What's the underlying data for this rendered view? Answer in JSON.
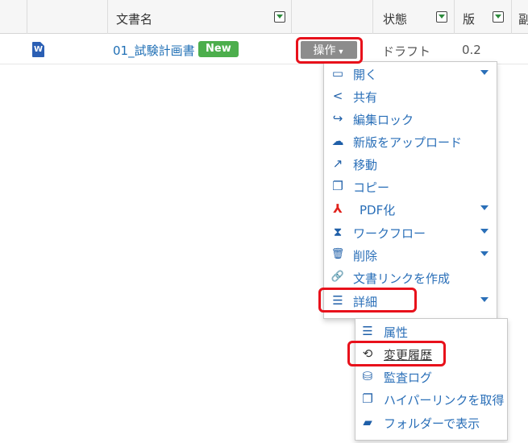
{
  "header": {
    "doc_name_label": "文書名",
    "status_label": "状態",
    "version_label": "版",
    "extra_label": "副"
  },
  "row": {
    "file_type_glyph": "W",
    "doc_name": "01_試験計画書",
    "new_badge": "New",
    "ops_label": "操作",
    "ops_chevron": "▼",
    "status": "ドラフト",
    "version": "0.2"
  },
  "menu": {
    "items": [
      {
        "label": "開く",
        "icon": "monitor-icon",
        "glyph": "▭"
      },
      {
        "label": "共有",
        "icon": "share-icon",
        "glyph": "<"
      },
      {
        "label": "編集ロック",
        "icon": "sign-out-icon",
        "glyph": "↪"
      },
      {
        "label": "新版をアップロード",
        "icon": "cloud-upload-icon",
        "glyph": "☁"
      },
      {
        "label": "移動",
        "icon": "external-link-icon",
        "glyph": "↗"
      },
      {
        "label": "コピー",
        "icon": "copy-icon",
        "glyph": "❐"
      },
      {
        "label": "PDF化",
        "icon": "pdf-icon",
        "glyph": "⅄"
      },
      {
        "label": "ワークフロー",
        "icon": "hourglass-icon",
        "glyph": "⧗"
      },
      {
        "label": "削除",
        "icon": "trash-icon",
        "glyph": "🗑"
      },
      {
        "label": "文書リンクを作成",
        "icon": "link-icon",
        "glyph": "🔗"
      },
      {
        "label": "詳細",
        "icon": "list-icon",
        "glyph": "☰"
      }
    ]
  },
  "submenu": {
    "items": [
      {
        "label": "属性",
        "icon": "list-icon",
        "glyph": "☰"
      },
      {
        "label": "変更履歴",
        "icon": "history-icon",
        "glyph": "⟲"
      },
      {
        "label": "監査ログ",
        "icon": "database-icon",
        "glyph": "⛁"
      },
      {
        "label": "ハイパーリンクを取得",
        "icon": "copy-icon",
        "glyph": "❐"
      },
      {
        "label": "フォルダーで表示",
        "icon": "folder-open-icon",
        "glyph": "▰"
      }
    ]
  },
  "colors": {
    "accent": "#2a6fb8",
    "badge": "#4cae4c",
    "ops_button": "#8c8c8c",
    "highlight": "#e8111b",
    "pdf_icon": "#e0211b"
  }
}
